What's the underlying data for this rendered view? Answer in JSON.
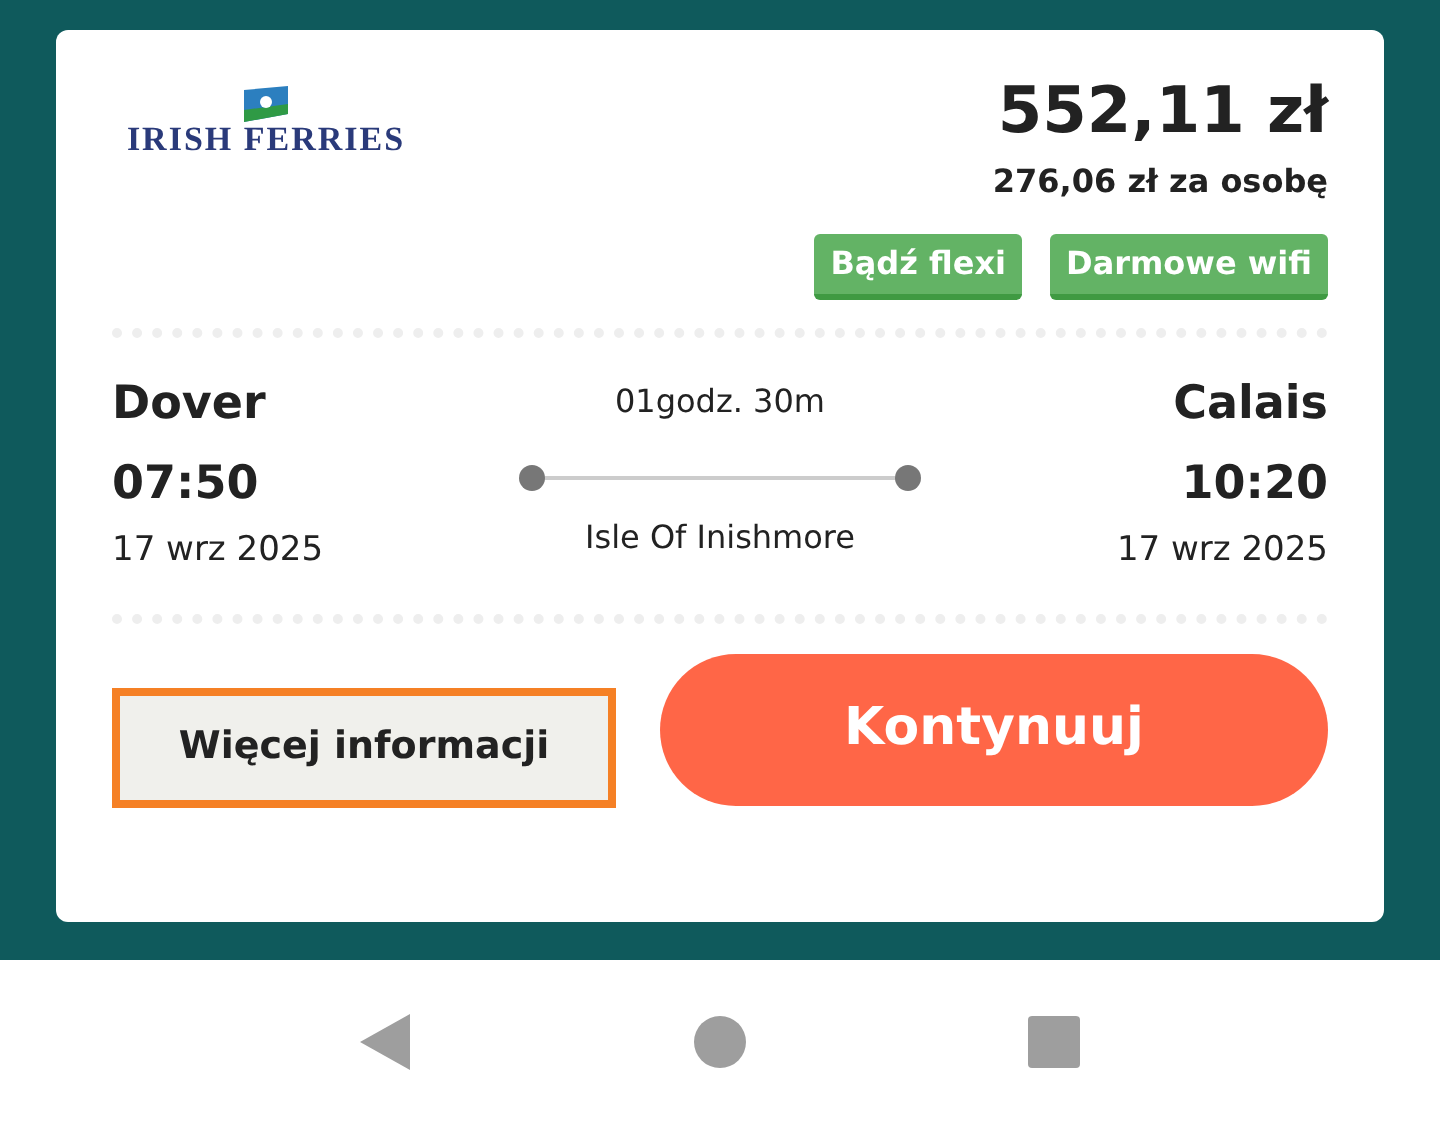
{
  "logo": {
    "text": "IRISH FERRIES"
  },
  "price": {
    "total": "552,11 zł",
    "per_person": "276,06 zł za osobę"
  },
  "tags": [
    "Bądź flexi",
    "Darmowe wifi"
  ],
  "route": {
    "from": {
      "city": "Dover",
      "time": "07:50",
      "date": "17 wrz 2025"
    },
    "to": {
      "city": "Calais",
      "time": "10:20",
      "date": "17 wrz 2025"
    },
    "duration": "01godz. 30m",
    "ship": "Isle Of Inishmore"
  },
  "buttons": [
    {
      "kind": "secondary",
      "label": "Więcej informacji",
      "focused": true
    },
    {
      "kind": "primary",
      "label": "Kontynuuj",
      "focused": false
    }
  ]
}
